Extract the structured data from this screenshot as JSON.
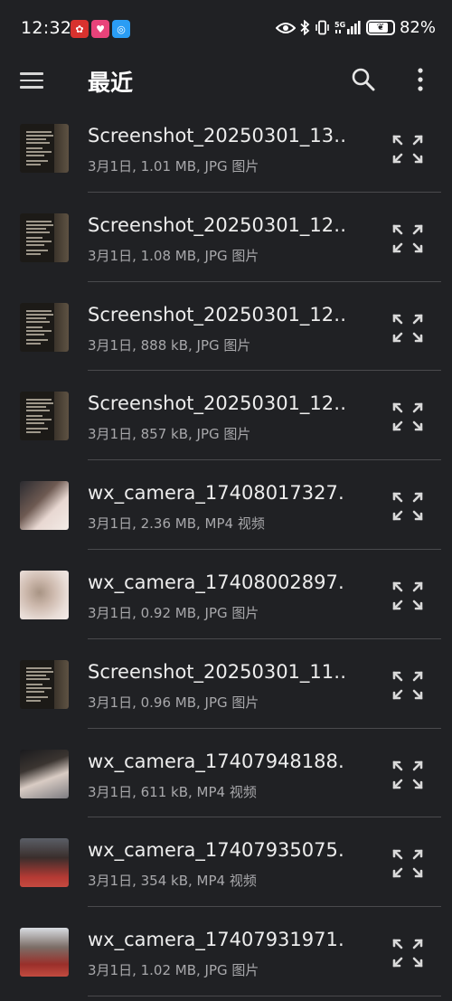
{
  "status_bar": {
    "time": "12:32",
    "battery_percent": "82%",
    "battery_level": 0.82,
    "network_label": "5G",
    "notification_icons": [
      "app-notification-icon-red",
      "app-notification-icon-pink",
      "app-notification-icon-blue"
    ],
    "system_icons": [
      "eye-icon",
      "bluetooth-icon",
      "vibrate-icon",
      "signal-5g-icon",
      "battery-saver-icon"
    ]
  },
  "app_bar": {
    "title": "最近",
    "icons": [
      "menu-icon",
      "search-icon",
      "more-vert-icon"
    ]
  },
  "files": [
    {
      "name": "Screenshot_20250301_13…",
      "meta": "3月1日, 1.01 MB, JPG 图片",
      "thumb": "screenshot"
    },
    {
      "name": "Screenshot_20250301_12…",
      "meta": "3月1日, 1.08 MB, JPG 图片",
      "thumb": "screenshot"
    },
    {
      "name": "Screenshot_20250301_12…",
      "meta": "3月1日, 888 kB, JPG 图片",
      "thumb": "screenshot"
    },
    {
      "name": "Screenshot_20250301_12…",
      "meta": "3月1日, 857 kB, JPG 图片",
      "thumb": "screenshot"
    },
    {
      "name": "wx_camera_17408017327…",
      "meta": "3月1日, 2.36 MB, MP4 视频",
      "thumb": "photo-a"
    },
    {
      "name": "wx_camera_17408002897…",
      "meta": "3月1日, 0.92 MB, JPG 图片",
      "thumb": "photo-b"
    },
    {
      "name": "Screenshot_20250301_11…",
      "meta": "3月1日, 0.96 MB, JPG 图片",
      "thumb": "screenshot"
    },
    {
      "name": "wx_camera_17407948188…",
      "meta": "3月1日, 611 kB, MP4 视频",
      "thumb": "photo-c"
    },
    {
      "name": "wx_camera_17407935075…",
      "meta": "3月1日, 354 kB, MP4 视频",
      "thumb": "photo-d"
    },
    {
      "name": "wx_camera_17407931971…",
      "meta": "3月1日, 1.02 MB, JPG 图片",
      "thumb": "photo-e"
    }
  ],
  "row_action_icon": "expand-icon",
  "colors": {
    "background": "#202124",
    "primary_text": "#ededed",
    "secondary_text": "#a8a8ab",
    "divider": "#4a4a4d"
  }
}
